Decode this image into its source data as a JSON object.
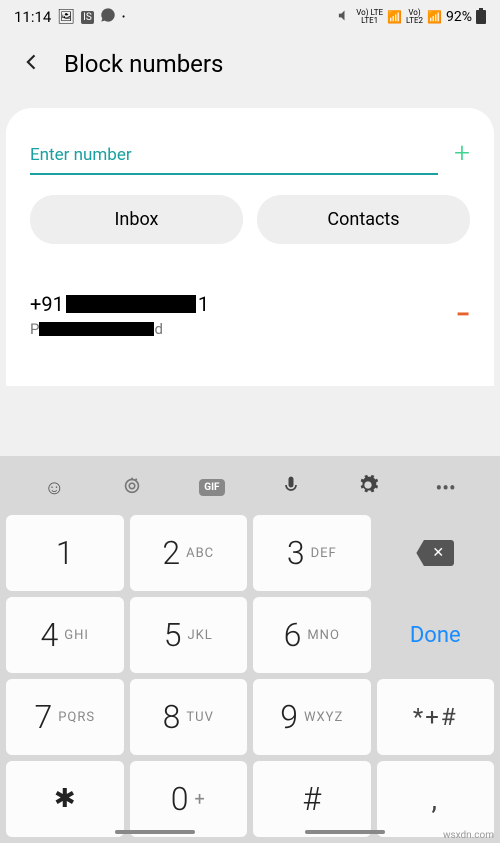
{
  "status": {
    "time": "11:14",
    "battery": "92%",
    "sig1": "Vo) LTE",
    "sig1b": "LTE1",
    "sig2": "Vo)",
    "sig2b": "LTE2"
  },
  "header": {
    "title": "Block numbers"
  },
  "input": {
    "placeholder": "Enter number",
    "value": ""
  },
  "buttons": {
    "inbox": "Inbox",
    "contacts": "Contacts"
  },
  "blocked": {
    "prefix": "+91",
    "suffix_visible": "1"
  },
  "keypad": {
    "rows": [
      [
        {
          "d": "1",
          "l": ""
        },
        {
          "d": "2",
          "l": "ABC"
        },
        {
          "d": "3",
          "l": "DEF"
        },
        {
          "action": "backspace"
        }
      ],
      [
        {
          "d": "4",
          "l": "GHI"
        },
        {
          "d": "5",
          "l": "JKL"
        },
        {
          "d": "6",
          "l": "MNO"
        },
        {
          "action": "done",
          "label": "Done"
        }
      ],
      [
        {
          "d": "7",
          "l": "PQRS"
        },
        {
          "d": "8",
          "l": "TUV"
        },
        {
          "d": "9",
          "l": "WXYZ"
        },
        {
          "sym": "*+#"
        }
      ],
      [
        {
          "d": "✱",
          "l": ""
        },
        {
          "d": "0",
          "l": "+"
        },
        {
          "d": "#",
          "l": ""
        },
        {
          "sym": ","
        }
      ]
    ]
  },
  "watermark": "wsxdn.com"
}
